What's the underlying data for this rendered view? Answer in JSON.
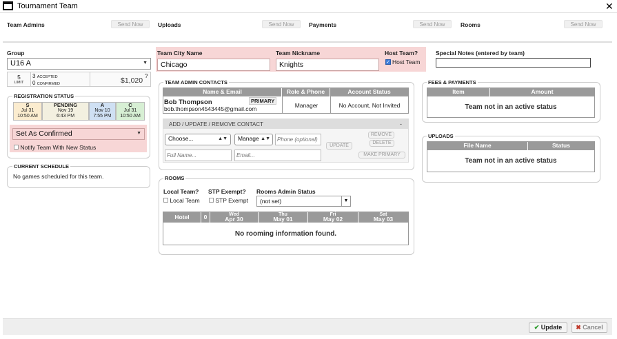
{
  "window": {
    "title": "Tournament Team"
  },
  "tabs": [
    {
      "label": "Team Admins",
      "send": "Send Now"
    },
    {
      "label": "Uploads",
      "send": "Send Now"
    },
    {
      "label": "Payments",
      "send": "Send Now"
    },
    {
      "label": "Rooms",
      "send": "Send Now"
    }
  ],
  "group": {
    "label": "Group",
    "value": "U16 A",
    "limit": "5",
    "limit_label": "LIMIT",
    "accepted": "3",
    "accepted_label": "ACCEPTED",
    "confirmed": "0",
    "confirmed_label": "CONFIRMED",
    "amount": "$1,020",
    "help": "?"
  },
  "team": {
    "city_label": "Team City Name",
    "city": "Chicago",
    "nickname_label": "Team Nickname",
    "nickname": "Knights",
    "host_label": "Host Team?",
    "host_checkbox": "Host Team",
    "host_checked": true,
    "notes_label": "Special Notes (entered by team)",
    "notes": ""
  },
  "registration": {
    "legend": "REGISTRATION STATUS",
    "history": [
      {
        "code": "S",
        "date": "Jul 31",
        "time": "10:50 AM",
        "color": "#fbeccf"
      },
      {
        "code": "PENDING",
        "date": "Nov 19",
        "time": "6:43 PM",
        "color": "#f3f0e0"
      },
      {
        "code": "A",
        "date": "Nov 10",
        "time": "7:55 PM",
        "color": "#cfe0f3"
      },
      {
        "code": "C",
        "date": "Jul 31",
        "time": "10:50 AM",
        "color": "#d7efd4"
      }
    ],
    "status_select": "Set As Confirmed",
    "notify_label": "Notify Team With New Status"
  },
  "schedule": {
    "legend": "CURRENT SCHEDULE",
    "text": "No games scheduled for this team."
  },
  "contacts": {
    "legend": "TEAM ADMIN CONTACTS",
    "headers": [
      "Name & Email",
      "Role & Phone",
      "Account Status"
    ],
    "rows": [
      {
        "name": "Bob Thompson",
        "badge": "PRIMARY",
        "email": "bob.thompson4543445@gmail.com",
        "role": "Manager",
        "status": "No Account, Not Invited"
      }
    ],
    "add_title": "ADD / UPDATE / REMOVE CONTACT",
    "collapse": "-",
    "choose": "Choose...",
    "manage": "Manage",
    "phone_placeholder": "Phone (optional)",
    "fullname_placeholder": "Full Name...",
    "email_placeholder": "Email...",
    "update_btn": "UPDATE",
    "remove_btn": "REMOVE",
    "delete_btn": "DELETE",
    "make_primary_btn": "MAKE PRIMARY"
  },
  "rooms": {
    "legend": "ROOMS",
    "local_label": "Local Team?",
    "local_checkbox": "Local Team",
    "stp_label": "STP Exempt?",
    "stp_checkbox": "STP Exempt",
    "admin_label": "Rooms Admin Status",
    "admin_value": "(not set)",
    "headers": [
      {
        "top": "",
        "bottom": "Hotel"
      },
      {
        "top": "",
        "bottom": "0"
      },
      {
        "top": "Wed",
        "bottom": "Apr 30"
      },
      {
        "top": "Thu",
        "bottom": "May 01"
      },
      {
        "top": "Fri",
        "bottom": "May 02"
      },
      {
        "top": "Sat",
        "bottom": "May 03"
      }
    ],
    "empty": "No rooming information found."
  },
  "fees": {
    "legend": "FEES & PAYMENTS",
    "headers": [
      "Item",
      "Amount"
    ],
    "empty": "Team not in an active status"
  },
  "uploads": {
    "legend": "UPLOADS",
    "headers": [
      "File Name",
      "Status"
    ],
    "empty": "Team not in an active status"
  },
  "footer": {
    "update": "Update",
    "cancel": "Cancel",
    "update_icon": "✔",
    "cancel_icon": "✖"
  }
}
